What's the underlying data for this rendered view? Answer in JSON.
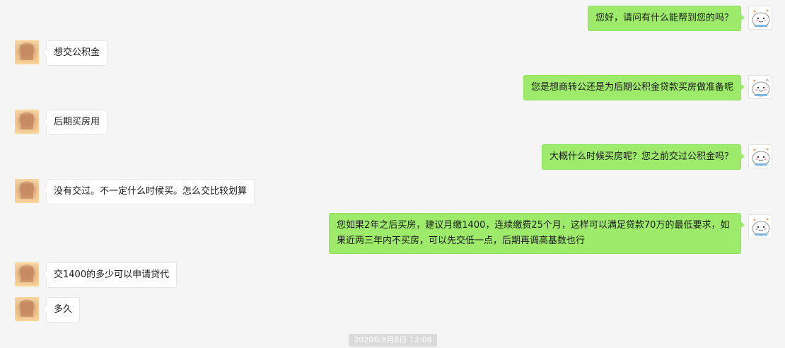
{
  "colors": {
    "background": "#f5f5f5",
    "sent_bubble": "#9eea6a",
    "received_bubble": "#ffffff",
    "timestamp_bg": "#dadada"
  },
  "messages": [
    {
      "side": "right",
      "text": "您好，请问有什么能帮到您的吗？"
    },
    {
      "side": "left",
      "text": "想交公积金"
    },
    {
      "side": "right",
      "text": "您是想商转公还是为后期公积金贷款买房做准备呢"
    },
    {
      "side": "left",
      "text": "后期买房用"
    },
    {
      "side": "right",
      "text": "大概什么时候买房呢？您之前交过公积金吗？"
    },
    {
      "side": "left",
      "text": "没有交过。不一定什么时候买。怎么交比较划算"
    },
    {
      "side": "right",
      "text": "您如果2年之后买房，建议月缴1400，连续缴费25个月，这样可以满足贷款70万的最低要求，如果近两三年内不买房，可以先交低一点，后期再调高基数也行"
    },
    {
      "side": "left",
      "text": "交1400的多少可以申请贷代"
    },
    {
      "side": "left",
      "text": "多久"
    }
  ],
  "timestamp": "2020年9月8日 12:08"
}
